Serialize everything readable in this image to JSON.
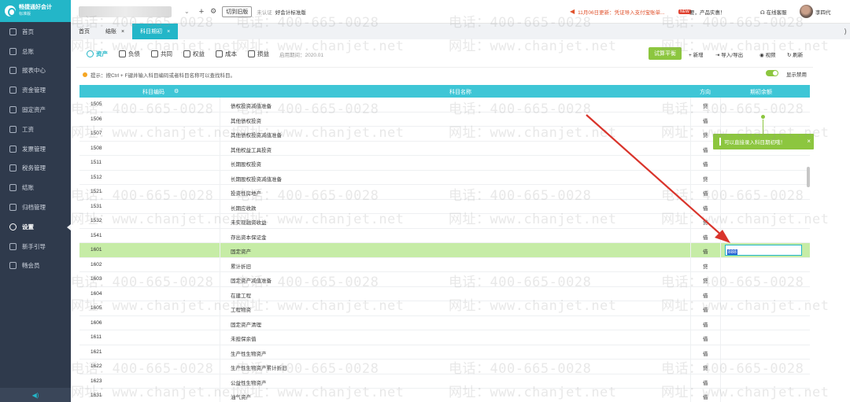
{
  "app": {
    "name": "畅捷通好会计",
    "edition": "标准版"
  },
  "sidebar": {
    "items": [
      {
        "label": "首页",
        "icon": "home-icon"
      },
      {
        "label": "总账",
        "icon": "ledger-icon"
      },
      {
        "label": "报表中心",
        "icon": "chart-icon"
      },
      {
        "label": "资金管理",
        "icon": "wallet-icon"
      },
      {
        "label": "固定资产",
        "icon": "asset-icon"
      },
      {
        "label": "工资",
        "icon": "salary-icon"
      },
      {
        "label": "发票管理",
        "icon": "invoice-icon"
      },
      {
        "label": "税务管理",
        "icon": "tax-icon"
      },
      {
        "label": "结账",
        "icon": "close-books-icon"
      },
      {
        "label": "归档管理",
        "icon": "archive-icon"
      },
      {
        "label": "设置",
        "icon": "gear-icon"
      },
      {
        "label": "新手引导",
        "icon": "guide-icon"
      },
      {
        "label": "畅会员",
        "icon": "vip-icon"
      }
    ],
    "active_index": 10,
    "collapse_icon": "speaker-collapse-icon"
  },
  "topbar": {
    "switch_label": "切到旧版",
    "cert_label": "未认证",
    "standard_label": "好会计标准版",
    "notice": "11月06日更新：凭证导入支付宝账单...",
    "new_badge": "NEW",
    "promo": "要，产品实惠！",
    "service": "在线客服",
    "user": "李四代"
  },
  "tabs": [
    {
      "label": "首页",
      "closable": false
    },
    {
      "label": "结账",
      "closable": true
    },
    {
      "label": "科目期初",
      "closable": true
    }
  ],
  "subbar": {
    "categories": [
      {
        "label": "资产",
        "active": true
      },
      {
        "label": "负债",
        "active": false
      },
      {
        "label": "共同",
        "active": false
      },
      {
        "label": "权益",
        "active": false
      },
      {
        "label": "成本",
        "active": false
      },
      {
        "label": "损益",
        "active": false
      }
    ],
    "period": "启用期间：2020.01",
    "trial_button": "试算平衡",
    "actions": {
      "add": "新增",
      "import_export": "导入/导出",
      "video": "视频",
      "refresh": "刷新"
    }
  },
  "hint": "提示：按Ctrl + F键并输入科目编码或者科目名称可以查找科目。",
  "show_disabled": "显示禁用",
  "table": {
    "headers": {
      "code": "科目编码",
      "name": "科目名称",
      "direction": "方向",
      "balance": "期初余额"
    },
    "rows": [
      {
        "code": "1505",
        "name": "债权投资减值准备",
        "dir": "贷"
      },
      {
        "code": "1506",
        "name": "其他债权投资",
        "dir": "借"
      },
      {
        "code": "1507",
        "name": "其他债权投资减值准备",
        "dir": "贷"
      },
      {
        "code": "1508",
        "name": "其他权益工具投资",
        "dir": "借"
      },
      {
        "code": "1511",
        "name": "长期股权投资",
        "dir": "借"
      },
      {
        "code": "1512",
        "name": "长期股权投资减值准备",
        "dir": "贷"
      },
      {
        "code": "1521",
        "name": "投资性房地产",
        "dir": "借"
      },
      {
        "code": "1531",
        "name": "长期应收款",
        "dir": "借"
      },
      {
        "code": "1532",
        "name": "未实现融资收益",
        "dir": "贷"
      },
      {
        "code": "1541",
        "name": "存出资本保证金",
        "dir": "借"
      },
      {
        "code": "1601",
        "name": "固定资产",
        "dir": "借",
        "selected": true,
        "balance": "888"
      },
      {
        "code": "1602",
        "name": "累计折旧",
        "dir": "贷"
      },
      {
        "code": "1603",
        "name": "固定资产减值准备",
        "dir": "贷"
      },
      {
        "code": "1604",
        "name": "在建工程",
        "dir": "借"
      },
      {
        "code": "1605",
        "name": "工程物资",
        "dir": "借"
      },
      {
        "code": "1606",
        "name": "固定资产清理",
        "dir": "借"
      },
      {
        "code": "1611",
        "name": "未担保余值",
        "dir": "借"
      },
      {
        "code": "1621",
        "name": "生产性生物资产",
        "dir": "借"
      },
      {
        "code": "1622",
        "name": "生产性生物资产累计折旧",
        "dir": "贷"
      },
      {
        "code": "1623",
        "name": "公益性生物资产",
        "dir": "借"
      },
      {
        "code": "1631",
        "name": "油气资产",
        "dir": "借"
      }
    ]
  },
  "tooltip": "可以直接录入科目期初哦！",
  "watermark": {
    "phone": "电话：400-665-0028",
    "site": "网址：www.chanjet.net"
  },
  "colors": {
    "accent": "#23b6c8",
    "green": "#8cc63f",
    "sidebar": "#2f3a4c",
    "selected_row": "#c6eca6",
    "arrow": "#d9342b"
  }
}
